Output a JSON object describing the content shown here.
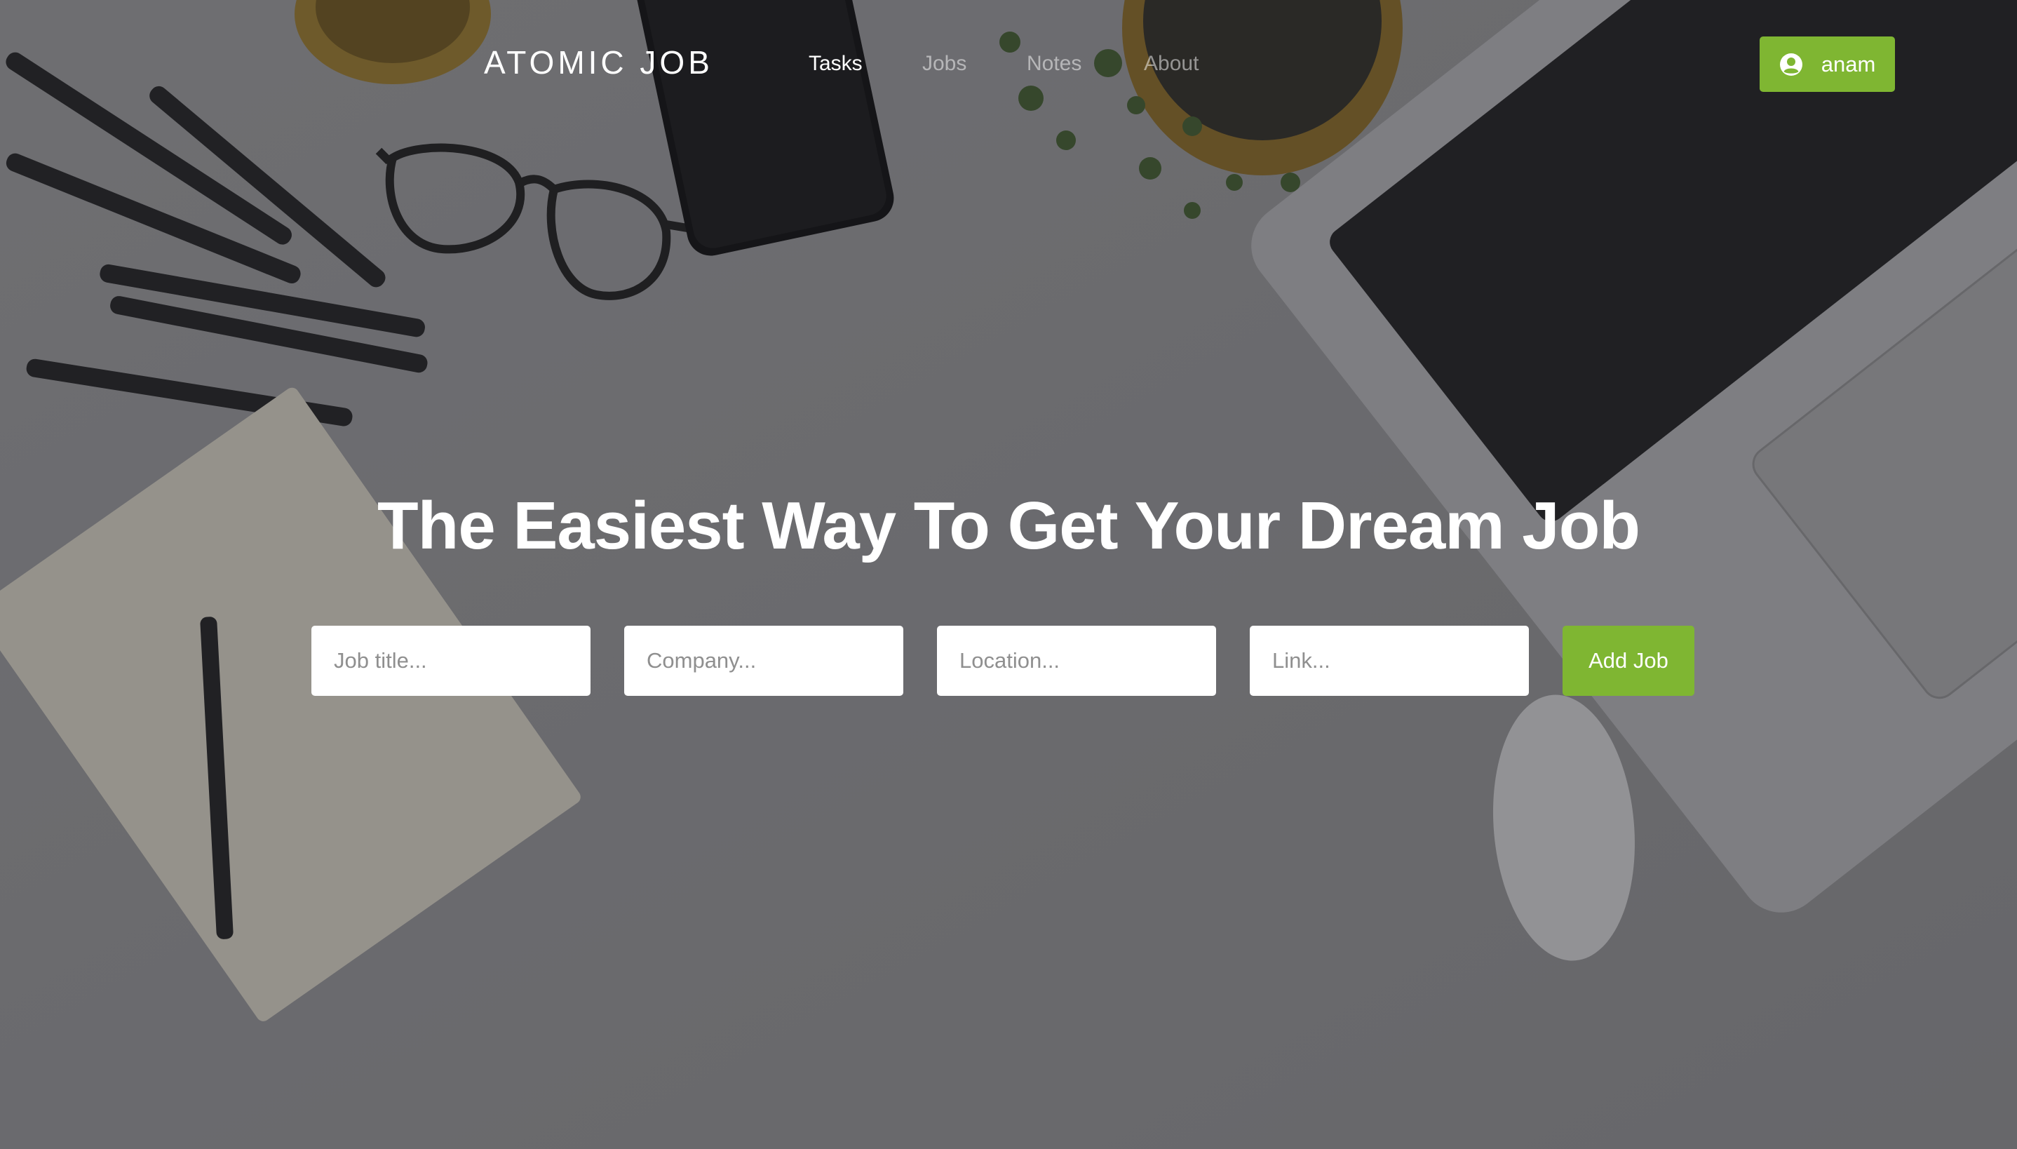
{
  "navbar": {
    "brand": "ATOMIC JOB",
    "links": [
      {
        "label": "Tasks",
        "active": true
      },
      {
        "label": "Jobs",
        "active": false
      },
      {
        "label": "Notes",
        "active": false
      },
      {
        "label": "About",
        "active": false
      }
    ],
    "user": {
      "name": "anam",
      "icon": "user-circle-icon"
    }
  },
  "hero": {
    "headline": "The Easiest Way To Get Your Dream Job"
  },
  "form": {
    "job_title_placeholder": "Job title...",
    "company_placeholder": "Company...",
    "location_placeholder": "Location...",
    "link_placeholder": "Link...",
    "submit_label": "Add Job"
  },
  "colors": {
    "accent": "#7fb632",
    "text_light": "#ffffff"
  }
}
